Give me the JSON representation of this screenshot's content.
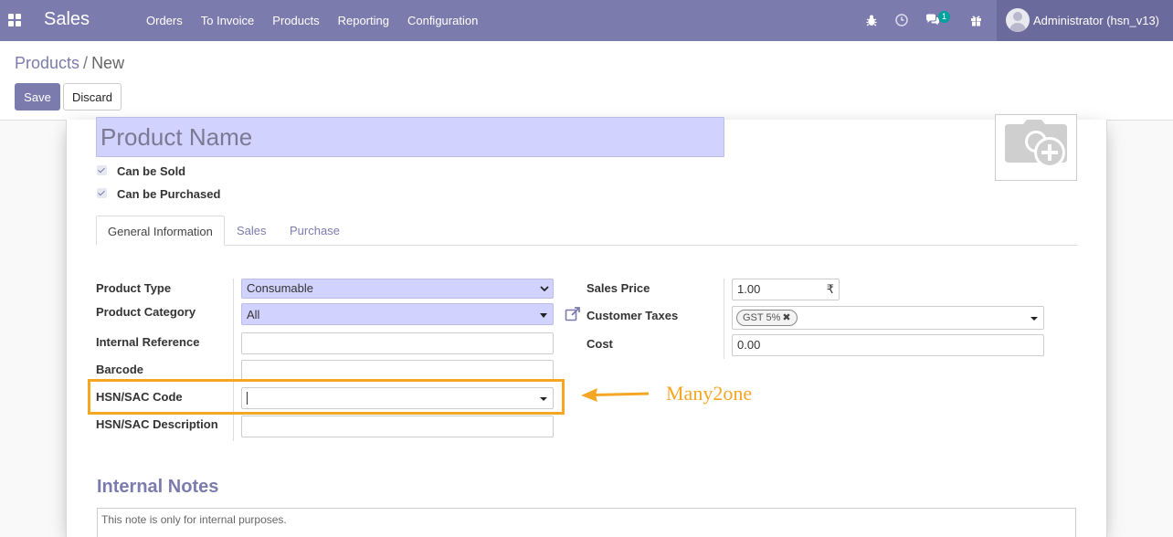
{
  "navbar": {
    "app_name": "Sales",
    "menu": [
      "Orders",
      "To Invoice",
      "Products",
      "Reporting",
      "Configuration"
    ],
    "messages_badge": "1",
    "user_name": "Administrator (hsn_v13)",
    "icons": [
      "apps-icon",
      "bug-icon",
      "clock-icon",
      "chat-icon",
      "gift-icon"
    ]
  },
  "control_panel": {
    "breadcrumb_parent": "Products",
    "breadcrumb_sep": "/",
    "breadcrumb_current": "New",
    "save_label": "Save",
    "discard_label": "Discard"
  },
  "form": {
    "product_name_placeholder": "Product Name",
    "can_be_sold": "Can be Sold",
    "can_be_purchased": "Can be Purchased",
    "tabs": [
      "General Information",
      "Sales",
      "Purchase"
    ],
    "left": {
      "product_type_label": "Product Type",
      "product_type_value": "Consumable",
      "product_category_label": "Product Category",
      "product_category_value": "All",
      "internal_reference_label": "Internal Reference",
      "barcode_label": "Barcode",
      "hsn_code_label": "HSN/SAC Code",
      "hsn_description_label": "HSN/SAC Description"
    },
    "right": {
      "sales_price_label": "Sales Price",
      "sales_price_value": "1.00",
      "currency_symbol": "₹",
      "customer_taxes_label": "Customer Taxes",
      "customer_taxes_tag": "GST 5%",
      "cost_label": "Cost",
      "cost_value": "0.00"
    },
    "internal_notes_title": "Internal Notes",
    "internal_notes_placeholder": "This note is only for internal purposes."
  },
  "annotation": {
    "text": "Many2one",
    "color": "#f5a623"
  },
  "colors": {
    "navbar": "#7c7bad",
    "accent": "#7c7bad",
    "required_field": "#d2d2ff"
  }
}
